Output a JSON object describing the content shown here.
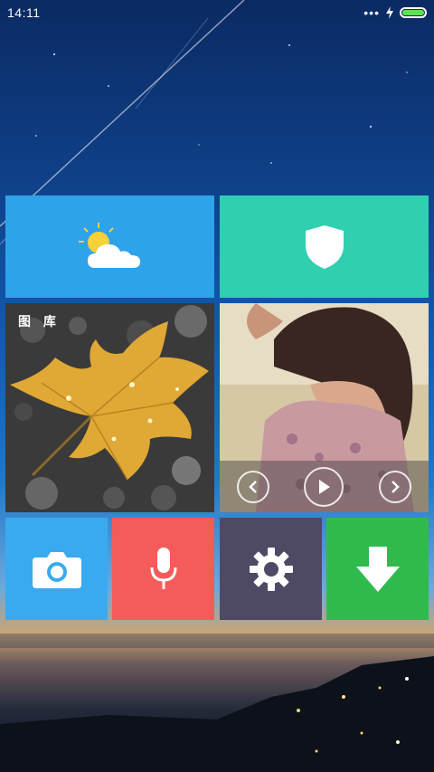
{
  "status_bar": {
    "time": "14:11",
    "signal_dots": "•••"
  },
  "tiles": {
    "gallery": {
      "label": "图 库"
    }
  },
  "colors": {
    "weather": "#2ea3ea",
    "shield": "#2fcfb0",
    "camera": "#3aaaf0",
    "mic": "#f45b5b",
    "settings": "#4e4a66",
    "download": "#2fba4e",
    "battery": "#5ee25a"
  },
  "icons": {
    "weather": "partly-cloudy-icon",
    "shield": "shield-icon",
    "camera": "camera-icon",
    "mic": "microphone-icon",
    "settings": "gear-icon",
    "download": "arrow-down-icon",
    "prev": "chevron-left-icon",
    "play": "play-icon",
    "next": "chevron-right-icon"
  }
}
